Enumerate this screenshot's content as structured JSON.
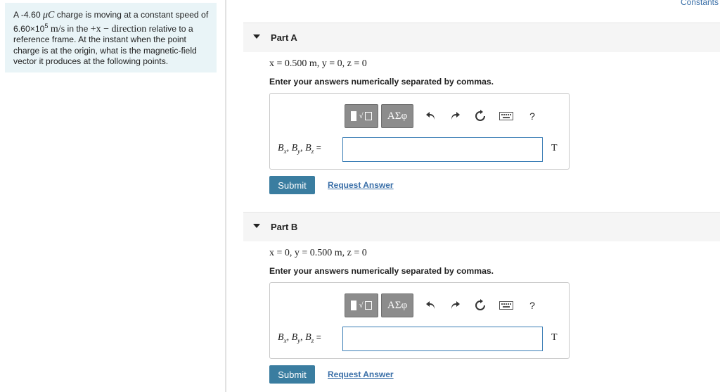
{
  "header": {
    "constants_link": "Constants"
  },
  "problem": {
    "text_1": "A -4.60 ",
    "unit_charge": "μC",
    "text_2": " charge is moving at a constant speed of 6.60×10",
    "exponent": "5",
    "unit_speed": " m/s",
    "text_3": " in the ",
    "direction": "+x − direction",
    "text_4": " relative to a reference frame. At the instant when the point charge is at the origin, what is the magnetic-field vector it produces at the following points."
  },
  "toolbar": {
    "template_frac": "□",
    "template_radical": "√",
    "greek": "ΑΣφ",
    "help": "?"
  },
  "parts": [
    {
      "title": "Part A",
      "coords": "x = 0.500 m,  y = 0, z = 0",
      "instruction": "Enter your answers numerically separated by commas.",
      "answer_label": "Bx, By, Bz =",
      "answer_value": "",
      "unit": "T",
      "submit": "Submit",
      "request": "Request Answer"
    },
    {
      "title": "Part B",
      "coords": "x = 0, y = 0.500 m, z = 0",
      "instruction": "Enter your answers numerically separated by commas.",
      "answer_label": "Bx, By, Bz =",
      "answer_value": "",
      "unit": "T",
      "submit": "Submit",
      "request": "Request Answer"
    }
  ]
}
